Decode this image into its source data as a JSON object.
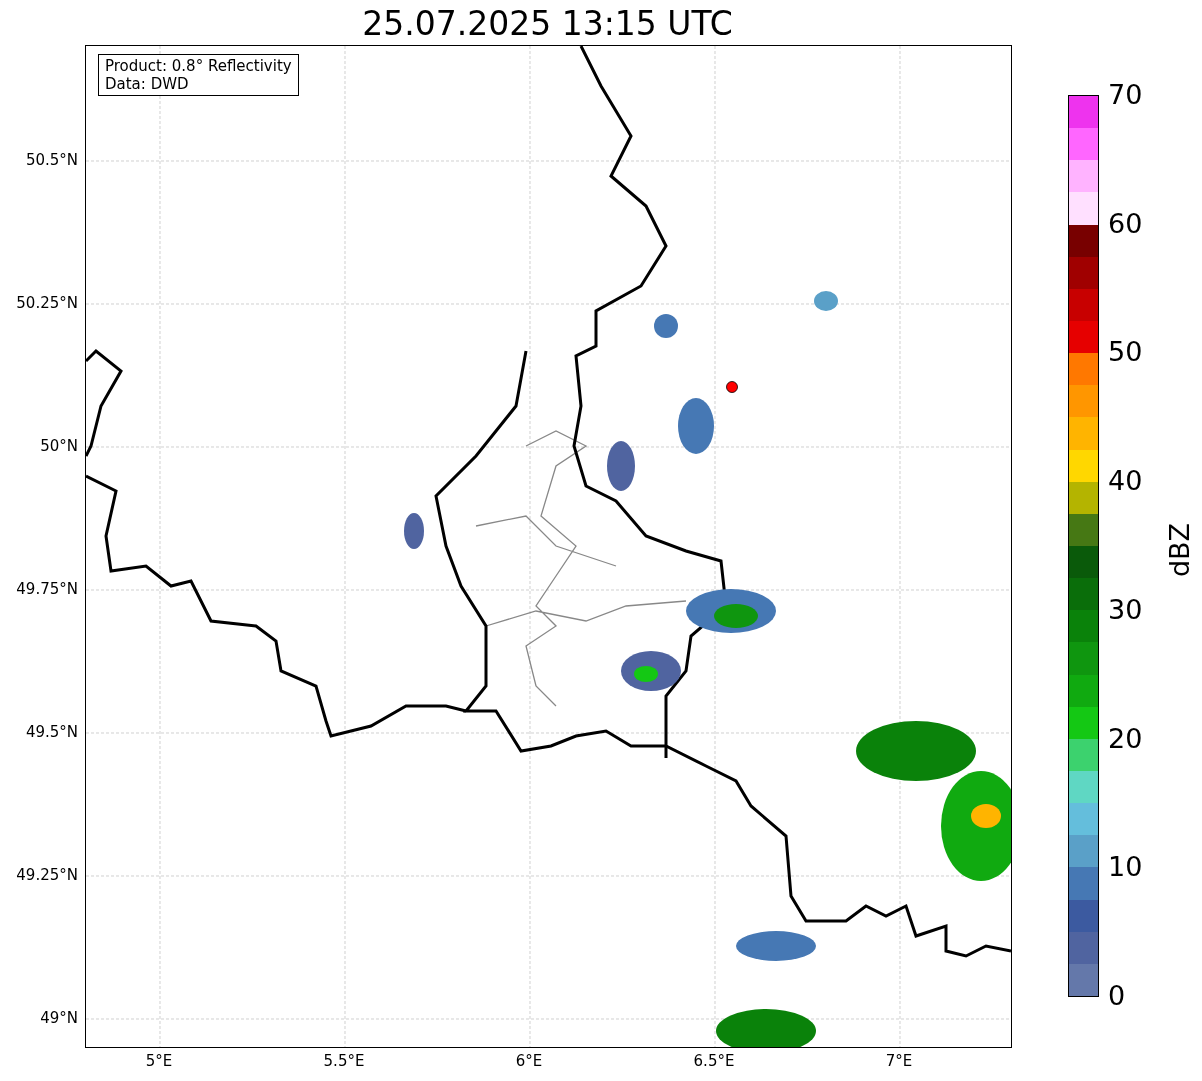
{
  "title": "25.07.2025 13:15 UTC",
  "info_box": [
    "Product: 0.8° Reflectivity",
    "Data: DWD"
  ],
  "lat_ticks": [
    "50.5°N",
    "50.25°N",
    "50°N",
    "49.75°N",
    "49.5°N",
    "49.25°N",
    "49°N"
  ],
  "lon_ticks": [
    "5°E",
    "5.5°E",
    "6°E",
    "6.5°E",
    "7°E"
  ],
  "colorbar": {
    "label": "dBZ",
    "ticks": [
      "70",
      "60",
      "50",
      "40",
      "30",
      "20",
      "10",
      "0"
    ],
    "bands": [
      {
        "color": "#ee33ee"
      },
      {
        "color": "#ff66ff"
      },
      {
        "color": "#ffb3ff"
      },
      {
        "color": "#ffe0ff"
      },
      {
        "color": "#780000"
      },
      {
        "color": "#a00000"
      },
      {
        "color": "#c80000"
      },
      {
        "color": "#e60000"
      },
      {
        "color": "#ff7800"
      },
      {
        "color": "#ff9600"
      },
      {
        "color": "#ffb400"
      },
      {
        "color": "#ffd700"
      },
      {
        "color": "#b4b400"
      },
      {
        "color": "#467814"
      },
      {
        "color": "#0a5a0a"
      },
      {
        "color": "#0a6e0a"
      },
      {
        "color": "#0a820a"
      },
      {
        "color": "#0f960f"
      },
      {
        "color": "#10aa10"
      },
      {
        "color": "#14c814"
      },
      {
        "color": "#3cd26e"
      },
      {
        "color": "#5fd7c3"
      },
      {
        "color": "#64bedc"
      },
      {
        "color": "#5aa0c8"
      },
      {
        "color": "#4678b4"
      },
      {
        "color": "#3c5aa0"
      },
      {
        "color": "#5064a0"
      },
      {
        "color": "#6478aa"
      }
    ]
  }
}
